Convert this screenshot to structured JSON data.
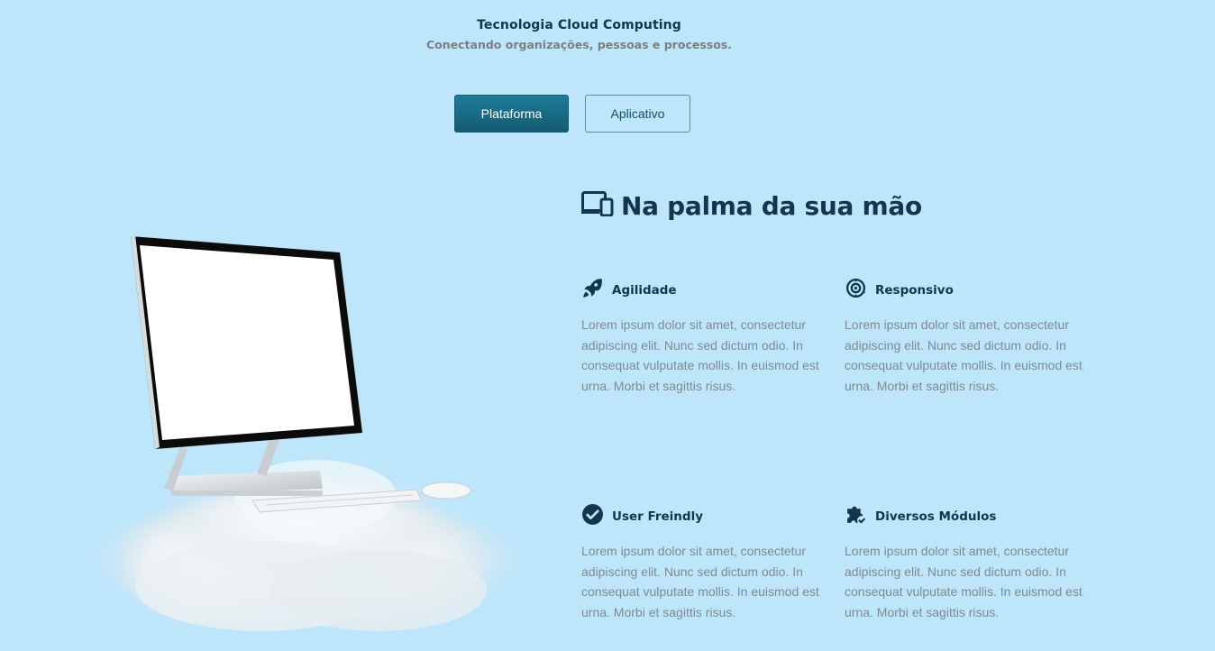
{
  "header": {
    "title": "Tecnologia Cloud Computing",
    "subtitle": "Conectando organizações, pessoas e processos."
  },
  "tabs": [
    {
      "label": "Plataforma",
      "active": true
    },
    {
      "label": "Aplicativo",
      "active": false
    }
  ],
  "section": {
    "heading": "Na palma da sua mão",
    "heading_icon": "devices-icon"
  },
  "features": [
    {
      "title": "Agilidade",
      "icon": "rocket-icon",
      "text": "Lorem ipsum dolor sit amet, consectetur adipiscing elit. Nunc sed dictum odio. In consequat vulputate mollis. In euismod est urna. Morbi et sagittis risus."
    },
    {
      "title": "Responsivo",
      "icon": "gear-sync-icon",
      "text": "Lorem ipsum dolor sit amet, consectetur adipiscing elit. Nunc sed dictum odio. In consequat vulputate mollis. In euismod est urna. Morbi et sagittis risus."
    },
    {
      "title": "User Freindly",
      "icon": "check-circle-icon",
      "text": "Lorem ipsum dolor sit amet, consectetur adipiscing elit. Nunc sed dictum odio. In consequat vulputate mollis. In euismod est urna. Morbi et sagittis risus."
    },
    {
      "title": "Diversos Módulos",
      "icon": "puzzle-check-icon",
      "text": "Lorem ipsum dolor sit amet, consectetur adipiscing elit. Nunc sed dictum odio. In consequat vulputate mollis. In euismod est urna. Morbi et sagittis risus."
    }
  ],
  "colors": {
    "background": "#bde6fb",
    "primary": "#1a6b86",
    "heading": "#133650",
    "body_text": "#7e8a92"
  }
}
